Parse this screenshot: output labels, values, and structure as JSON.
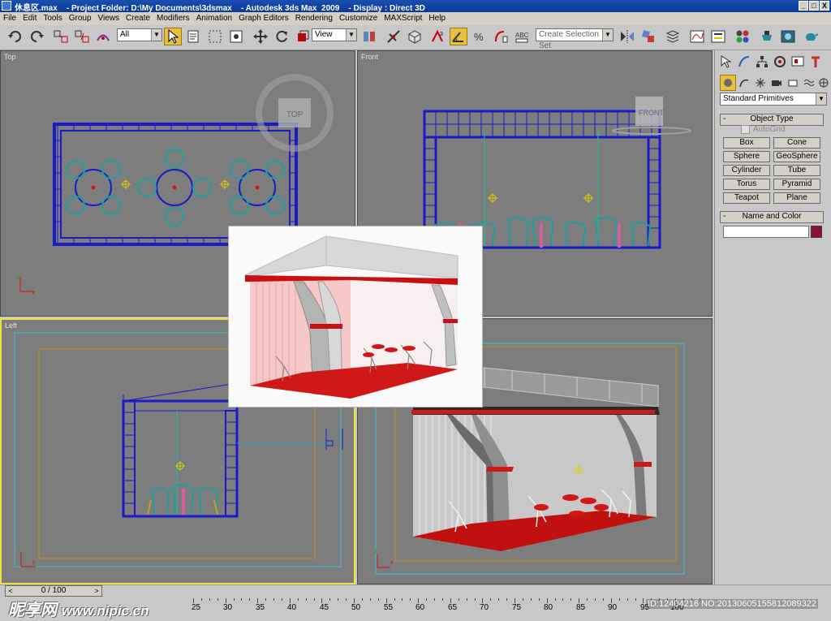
{
  "window": {
    "title": "休息区.max    - Project Folder: D:\\My Documents\\3dsmax    - Autodesk 3ds Max  2009    - Display : Direct 3D",
    "minimize": "_",
    "maximize": "□",
    "close": "X"
  },
  "menu": [
    "File",
    "Edit",
    "Tools",
    "Group",
    "Views",
    "Create",
    "Modifiers",
    "Animation",
    "Graph Editors",
    "Rendering",
    "Customize",
    "MAXScript",
    "Help"
  ],
  "toolbar": {
    "selection_filter": "All",
    "reference_coord": "View",
    "named_selection_placeholder": "Create Selection Set"
  },
  "viewports": {
    "top": {
      "label": "Top",
      "viewcube": "TOP"
    },
    "front": {
      "label": "Front",
      "viewcube": "FRONT"
    },
    "left": {
      "label": "Left"
    },
    "perspective": {
      "label": ""
    }
  },
  "command_panel": {
    "category_dropdown": "Standard Primitives",
    "object_type_title": "Object Type",
    "autogrid": "AutoGrid",
    "buttons": [
      "Box",
      "Cone",
      "Sphere",
      "GeoSphere",
      "Cylinder",
      "Tube",
      "Torus",
      "Pyramid",
      "Teapot",
      "Plane"
    ],
    "name_color_title": "Name and Color",
    "rollout_toggle": "-",
    "object_color": "#8a1038"
  },
  "timeline": {
    "slider": "0 / 100",
    "prev": "<",
    "next": ">",
    "ruler": [
      "25",
      "30",
      "35",
      "40",
      "45",
      "50",
      "55",
      "60",
      "65",
      "70",
      "75",
      "80",
      "85",
      "90",
      "95",
      "100"
    ]
  },
  "watermark": {
    "brand": "昵享网",
    "url": "www.nipic.cn",
    "id": "ID:12404216 NO:20130605155812089322"
  },
  "colors": {
    "wire_blue": "#1a1ac8",
    "chair_teal": "#1aa0a0",
    "curtain_red": "#d01818",
    "active_border": "#f0e040"
  }
}
